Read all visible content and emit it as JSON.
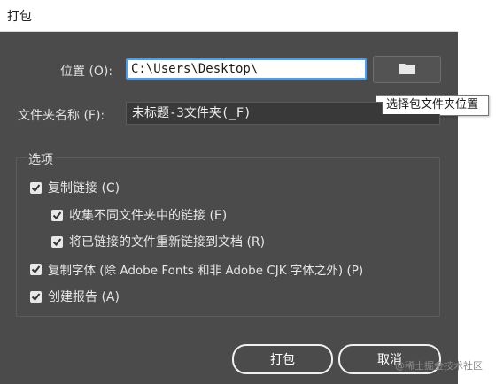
{
  "window": {
    "title": "打包"
  },
  "location": {
    "label": "位置 (O):",
    "value": "C:\\Users\\Desktop\\",
    "browse_icon": "folder-icon",
    "tooltip": "选择包文件夹位置"
  },
  "folder_name": {
    "label": "文件夹名称 (F):",
    "value": "未标题-3文件夹(_F)"
  },
  "options": {
    "legend": "选项",
    "items": [
      {
        "label": "复制链接 (C)",
        "checked": true
      },
      {
        "label": "收集不同文件夹中的链接 (E)",
        "checked": true
      },
      {
        "label": "将已链接的文件重新链接到文档 (R)",
        "checked": true
      },
      {
        "label": "复制字体 (除 Adobe Fonts 和非 Adobe CJK 字体之外) (P)",
        "checked": true
      },
      {
        "label": "创建报告 (A)",
        "checked": true
      }
    ]
  },
  "buttons": {
    "package": "打包",
    "cancel": "取消"
  },
  "watermark": "@稀土掘金技术社区",
  "colors": {
    "focus_border": "#46a0f5",
    "dialog_bg": "#4b4b4b"
  }
}
